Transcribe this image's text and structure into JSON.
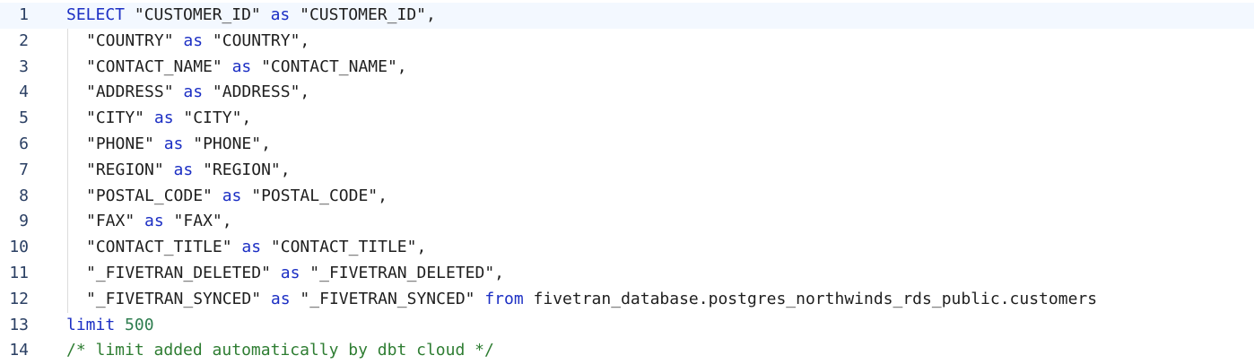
{
  "editor": {
    "language": "sql",
    "active_line": 1,
    "colors": {
      "keyword": "#1c2fc4",
      "number": "#2e7d4f",
      "comment": "#2e7d32",
      "plain": "#1f1f1f",
      "gutter": "#2a3f63",
      "active_line_bg": "#f3f8ff"
    },
    "lines": [
      {
        "number": "1",
        "indent": false,
        "tokens": [
          {
            "type": "keyword",
            "text": "SELECT"
          },
          {
            "type": "plain",
            "text": " \"CUSTOMER_ID\" "
          },
          {
            "type": "keyword",
            "text": "as"
          },
          {
            "type": "plain",
            "text": " \"CUSTOMER_ID\","
          }
        ]
      },
      {
        "number": "2",
        "indent": true,
        "tokens": [
          {
            "type": "plain",
            "text": "\"COUNTRY\" "
          },
          {
            "type": "keyword",
            "text": "as"
          },
          {
            "type": "plain",
            "text": " \"COUNTRY\","
          }
        ]
      },
      {
        "number": "3",
        "indent": true,
        "tokens": [
          {
            "type": "plain",
            "text": "\"CONTACT_NAME\" "
          },
          {
            "type": "keyword",
            "text": "as"
          },
          {
            "type": "plain",
            "text": " \"CONTACT_NAME\","
          }
        ]
      },
      {
        "number": "4",
        "indent": true,
        "tokens": [
          {
            "type": "plain",
            "text": "\"ADDRESS\" "
          },
          {
            "type": "keyword",
            "text": "as"
          },
          {
            "type": "plain",
            "text": " \"ADDRESS\","
          }
        ]
      },
      {
        "number": "5",
        "indent": true,
        "tokens": [
          {
            "type": "plain",
            "text": "\"CITY\" "
          },
          {
            "type": "keyword",
            "text": "as"
          },
          {
            "type": "plain",
            "text": " \"CITY\","
          }
        ]
      },
      {
        "number": "6",
        "indent": true,
        "tokens": [
          {
            "type": "plain",
            "text": "\"PHONE\" "
          },
          {
            "type": "keyword",
            "text": "as"
          },
          {
            "type": "plain",
            "text": " \"PHONE\","
          }
        ]
      },
      {
        "number": "7",
        "indent": true,
        "tokens": [
          {
            "type": "plain",
            "text": "\"REGION\" "
          },
          {
            "type": "keyword",
            "text": "as"
          },
          {
            "type": "plain",
            "text": " \"REGION\","
          }
        ]
      },
      {
        "number": "8",
        "indent": true,
        "tokens": [
          {
            "type": "plain",
            "text": "\"POSTAL_CODE\" "
          },
          {
            "type": "keyword",
            "text": "as"
          },
          {
            "type": "plain",
            "text": " \"POSTAL_CODE\","
          }
        ]
      },
      {
        "number": "9",
        "indent": true,
        "tokens": [
          {
            "type": "plain",
            "text": "\"FAX\" "
          },
          {
            "type": "keyword",
            "text": "as"
          },
          {
            "type": "plain",
            "text": " \"FAX\","
          }
        ]
      },
      {
        "number": "10",
        "indent": true,
        "tokens": [
          {
            "type": "plain",
            "text": "\"CONTACT_TITLE\" "
          },
          {
            "type": "keyword",
            "text": "as"
          },
          {
            "type": "plain",
            "text": " \"CONTACT_TITLE\","
          }
        ]
      },
      {
        "number": "11",
        "indent": true,
        "tokens": [
          {
            "type": "plain",
            "text": "\"_FIVETRAN_DELETED\" "
          },
          {
            "type": "keyword",
            "text": "as"
          },
          {
            "type": "plain",
            "text": " \"_FIVETRAN_DELETED\","
          }
        ]
      },
      {
        "number": "12",
        "indent": true,
        "tokens": [
          {
            "type": "plain",
            "text": "\"_FIVETRAN_SYNCED\" "
          },
          {
            "type": "keyword",
            "text": "as"
          },
          {
            "type": "plain",
            "text": " \"_FIVETRAN_SYNCED\" "
          },
          {
            "type": "keyword",
            "text": "from"
          },
          {
            "type": "plain",
            "text": " fivetran_database.postgres_northwinds_rds_public.customers"
          }
        ]
      },
      {
        "number": "13",
        "indent": false,
        "tokens": [
          {
            "type": "keyword",
            "text": "limit"
          },
          {
            "type": "plain",
            "text": " "
          },
          {
            "type": "number",
            "text": "500"
          }
        ]
      },
      {
        "number": "14",
        "indent": false,
        "tokens": [
          {
            "type": "comment",
            "text": "/* limit added automatically by dbt cloud */"
          }
        ]
      }
    ]
  }
}
